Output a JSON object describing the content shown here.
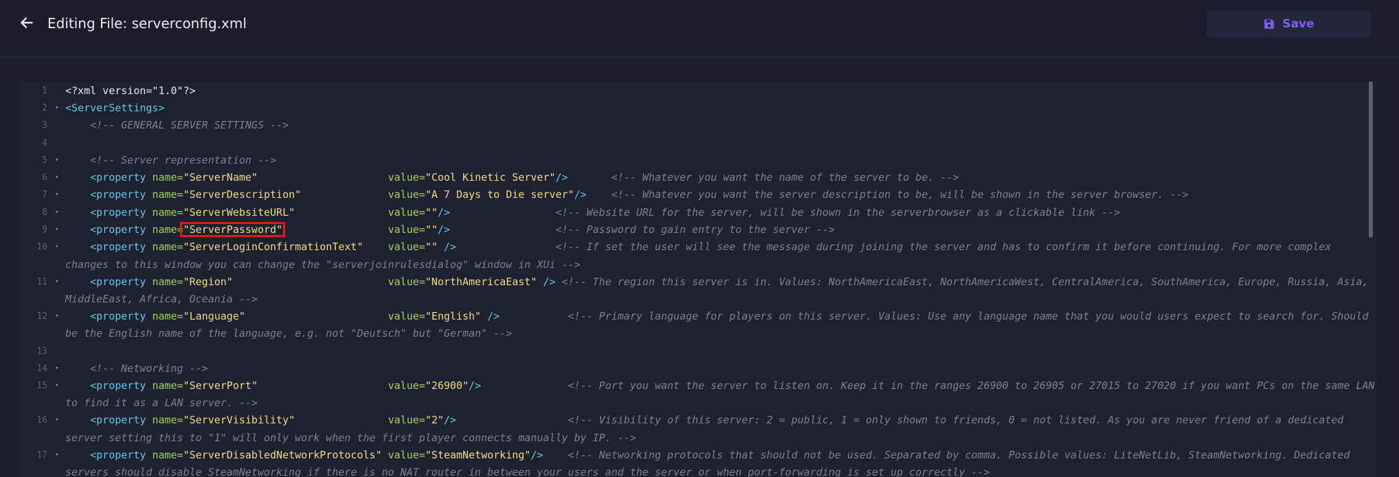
{
  "header": {
    "title": "Editing File: serverconfig.xml",
    "save_label": "Save",
    "back_icon": "arrow-left-icon",
    "save_icon": "floppy-disk-icon",
    "accent_color": "#7d5ff0"
  },
  "editor": {
    "lines": [
      {
        "num": "1",
        "fold": false,
        "segments": [
          {
            "t": "plain",
            "v": "<?xml version=\"1.0\"?>"
          }
        ]
      },
      {
        "num": "2",
        "fold": true,
        "segments": [
          {
            "t": "tag",
            "v": "<ServerSettings>"
          }
        ]
      },
      {
        "num": "3",
        "fold": false,
        "segments": [
          {
            "t": "plain",
            "v": "    "
          },
          {
            "t": "cmt",
            "v": "<!-- GENERAL SERVER SETTINGS -->"
          }
        ]
      },
      {
        "num": "4",
        "fold": false,
        "segments": []
      },
      {
        "num": "5",
        "fold": true,
        "segments": [
          {
            "t": "plain",
            "v": "    "
          },
          {
            "t": "cmt",
            "v": "<!-- Server representation -->"
          }
        ]
      },
      {
        "num": "6",
        "fold": true,
        "segments": [
          {
            "t": "plain",
            "v": "    "
          },
          {
            "t": "tag",
            "v": "<property "
          },
          {
            "t": "attr",
            "v": "name="
          },
          {
            "t": "str",
            "v": "\"ServerName\""
          },
          {
            "t": "plain",
            "v": "                     "
          },
          {
            "t": "attr",
            "v": "value="
          },
          {
            "t": "str",
            "v": "\"Cool Kinetic Server\""
          },
          {
            "t": "tag",
            "v": "/>"
          },
          {
            "t": "plain",
            "v": "       "
          },
          {
            "t": "cmt",
            "v": "<!-- Whatever you want the name of the server to be. -->"
          }
        ]
      },
      {
        "num": "7",
        "fold": true,
        "segments": [
          {
            "t": "plain",
            "v": "    "
          },
          {
            "t": "tag",
            "v": "<property "
          },
          {
            "t": "attr",
            "v": "name="
          },
          {
            "t": "str",
            "v": "\"ServerDescription\""
          },
          {
            "t": "plain",
            "v": "              "
          },
          {
            "t": "attr",
            "v": "value="
          },
          {
            "t": "str",
            "v": "\"A 7 Days to Die server\""
          },
          {
            "t": "tag",
            "v": "/>"
          },
          {
            "t": "plain",
            "v": "    "
          },
          {
            "t": "cmt",
            "v": "<!-- Whatever you want the server description to be, will be shown in the server browser. -->"
          }
        ]
      },
      {
        "num": "8",
        "fold": true,
        "segments": [
          {
            "t": "plain",
            "v": "    "
          },
          {
            "t": "tag",
            "v": "<property "
          },
          {
            "t": "attr",
            "v": "name="
          },
          {
            "t": "str",
            "v": "\"ServerWebsiteURL\""
          },
          {
            "t": "plain",
            "v": "               "
          },
          {
            "t": "attr",
            "v": "value="
          },
          {
            "t": "str",
            "v": "\"\""
          },
          {
            "t": "tag",
            "v": "/>"
          },
          {
            "t": "plain",
            "v": "                 "
          },
          {
            "t": "cmt",
            "v": "<!-- Website URL for the server, will be shown in the serverbrowser as a clickable link -->"
          }
        ]
      },
      {
        "num": "9",
        "fold": true,
        "highlight": true,
        "segments": [
          {
            "t": "plain",
            "v": "    "
          },
          {
            "t": "tag",
            "v": "<property "
          },
          {
            "t": "attr",
            "v": "name="
          },
          {
            "t": "str",
            "v": "\"ServerPassword\""
          },
          {
            "t": "plain",
            "v": "                 "
          },
          {
            "t": "attr",
            "v": "value="
          },
          {
            "t": "str",
            "v": "\"\""
          },
          {
            "t": "tag",
            "v": "/>"
          },
          {
            "t": "plain",
            "v": "                 "
          },
          {
            "t": "cmt",
            "v": "<!-- Password to gain entry to the server -->"
          }
        ]
      },
      {
        "num": "10",
        "fold": true,
        "segments": [
          {
            "t": "plain",
            "v": "    "
          },
          {
            "t": "tag",
            "v": "<property "
          },
          {
            "t": "attr",
            "v": "name="
          },
          {
            "t": "str",
            "v": "\"ServerLoginConfirmationText\""
          },
          {
            "t": "plain",
            "v": "    "
          },
          {
            "t": "attr",
            "v": "value="
          },
          {
            "t": "str",
            "v": "\"\""
          },
          {
            "t": "plain",
            "v": " "
          },
          {
            "t": "tag",
            "v": "/>"
          },
          {
            "t": "plain",
            "v": "                "
          },
          {
            "t": "cmt",
            "v": "<!-- If set the user will see the message during joining the server and has to confirm it before continuing. For more complex"
          }
        ]
      },
      {
        "num": "",
        "fold": false,
        "segments": [
          {
            "t": "cmt",
            "v": "changes to this window you can change the \"serverjoinrulesdialog\" window in XUi -->"
          }
        ]
      },
      {
        "num": "11",
        "fold": true,
        "segments": [
          {
            "t": "plain",
            "v": "    "
          },
          {
            "t": "tag",
            "v": "<property "
          },
          {
            "t": "attr",
            "v": "name="
          },
          {
            "t": "str",
            "v": "\"Region\""
          },
          {
            "t": "plain",
            "v": "                         "
          },
          {
            "t": "attr",
            "v": "value="
          },
          {
            "t": "str",
            "v": "\"NorthAmericaEast\""
          },
          {
            "t": "plain",
            "v": " "
          },
          {
            "t": "tag",
            "v": "/>"
          },
          {
            "t": "plain",
            "v": " "
          },
          {
            "t": "cmt",
            "v": "<!-- The region this server is in. Values: NorthAmericaEast, NorthAmericaWest, CentralAmerica, SouthAmerica, Europe, Russia, Asia,"
          }
        ]
      },
      {
        "num": "",
        "fold": false,
        "segments": [
          {
            "t": "cmt",
            "v": "MiddleEast, Africa, Oceania -->"
          }
        ]
      },
      {
        "num": "12",
        "fold": true,
        "segments": [
          {
            "t": "plain",
            "v": "    "
          },
          {
            "t": "tag",
            "v": "<property "
          },
          {
            "t": "attr",
            "v": "name="
          },
          {
            "t": "str",
            "v": "\"Language\""
          },
          {
            "t": "plain",
            "v": "                       "
          },
          {
            "t": "attr",
            "v": "value="
          },
          {
            "t": "str",
            "v": "\"English\""
          },
          {
            "t": "plain",
            "v": " "
          },
          {
            "t": "tag",
            "v": "/>"
          },
          {
            "t": "plain",
            "v": "           "
          },
          {
            "t": "cmt",
            "v": "<!-- Primary language for players on this server. Values: Use any language name that you would users expect to search for. Should"
          }
        ]
      },
      {
        "num": "",
        "fold": false,
        "segments": [
          {
            "t": "cmt",
            "v": "be the English name of the language, e.g. not \"Deutsch\" but \"German\" -->"
          }
        ]
      },
      {
        "num": "13",
        "fold": false,
        "segments": []
      },
      {
        "num": "14",
        "fold": true,
        "segments": [
          {
            "t": "plain",
            "v": "    "
          },
          {
            "t": "cmt",
            "v": "<!-- Networking -->"
          }
        ]
      },
      {
        "num": "15",
        "fold": true,
        "segments": [
          {
            "t": "plain",
            "v": "    "
          },
          {
            "t": "tag",
            "v": "<property "
          },
          {
            "t": "attr",
            "v": "name="
          },
          {
            "t": "str",
            "v": "\"ServerPort\""
          },
          {
            "t": "plain",
            "v": "                     "
          },
          {
            "t": "attr",
            "v": "value="
          },
          {
            "t": "str",
            "v": "\"26900\""
          },
          {
            "t": "tag",
            "v": "/>"
          },
          {
            "t": "plain",
            "v": "              "
          },
          {
            "t": "cmt",
            "v": "<!-- Port you want the server to listen on. Keep it in the ranges 26900 to 26905 or 27015 to 27020 if you want PCs on the same LAN"
          }
        ]
      },
      {
        "num": "",
        "fold": false,
        "segments": [
          {
            "t": "cmt",
            "v": "to find it as a LAN server. -->"
          }
        ]
      },
      {
        "num": "16",
        "fold": true,
        "segments": [
          {
            "t": "plain",
            "v": "    "
          },
          {
            "t": "tag",
            "v": "<property "
          },
          {
            "t": "attr",
            "v": "name="
          },
          {
            "t": "str",
            "v": "\"ServerVisibility\""
          },
          {
            "t": "plain",
            "v": "               "
          },
          {
            "t": "attr",
            "v": "value="
          },
          {
            "t": "str",
            "v": "\"2\""
          },
          {
            "t": "tag",
            "v": "/>"
          },
          {
            "t": "plain",
            "v": "                  "
          },
          {
            "t": "cmt",
            "v": "<!-- Visibility of this server: 2 = public, 1 = only shown to friends, 0 = not listed. As you are never friend of a dedicated"
          }
        ]
      },
      {
        "num": "",
        "fold": false,
        "segments": [
          {
            "t": "cmt",
            "v": "server setting this to \"1\" will only work when the first player connects manually by IP. -->"
          }
        ]
      },
      {
        "num": "17",
        "fold": true,
        "segments": [
          {
            "t": "plain",
            "v": "    "
          },
          {
            "t": "tag",
            "v": "<property "
          },
          {
            "t": "attr",
            "v": "name="
          },
          {
            "t": "str",
            "v": "\"ServerDisabledNetworkProtocols\""
          },
          {
            "t": "plain",
            "v": " "
          },
          {
            "t": "attr",
            "v": "value="
          },
          {
            "t": "str",
            "v": "\"SteamNetworking\""
          },
          {
            "t": "tag",
            "v": "/>"
          },
          {
            "t": "plain",
            "v": "    "
          },
          {
            "t": "cmt",
            "v": "<!-- Networking protocols that should not be used. Separated by comma. Possible values: LiteNetLib, SteamNetworking. Dedicated"
          }
        ]
      },
      {
        "num": "",
        "fold": false,
        "segments": [
          {
            "t": "cmt",
            "v": "servers should disable SteamNetworking if there is no NAT router in between your users and the server or when port-forwarding is set up correctly -->"
          }
        ]
      }
    ]
  }
}
